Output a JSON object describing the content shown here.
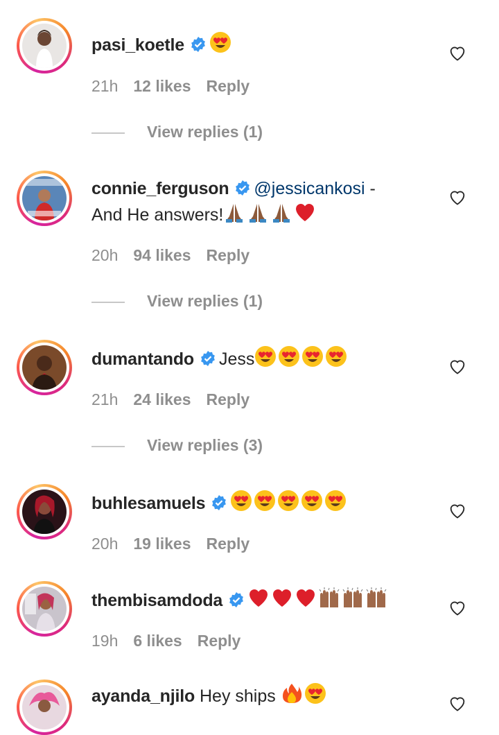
{
  "comments": [
    {
      "username": "pasi_koetle",
      "verified": true,
      "text": "",
      "emojis": [
        "heart-eyes"
      ],
      "time": "21h",
      "likes": "12 likes",
      "reply": "Reply",
      "view_replies": "View replies (1)"
    },
    {
      "username": "connie_ferguson",
      "verified": true,
      "mention": "@jessicankosi",
      "text_line1_suffix": " -",
      "text_line2": "And He answers!",
      "emojis": [
        "folded-hands",
        "folded-hands",
        "folded-hands",
        "red-heart"
      ],
      "time": "20h",
      "likes": "94 likes",
      "reply": "Reply",
      "view_replies": "View replies (1)"
    },
    {
      "username": "dumantando",
      "verified": true,
      "text": "Jess",
      "emojis": [
        "heart-eyes",
        "heart-eyes",
        "heart-eyes",
        "heart-eyes"
      ],
      "time": "21h",
      "likes": "24 likes",
      "reply": "Reply",
      "view_replies": "View replies (3)"
    },
    {
      "username": "buhlesamuels",
      "verified": true,
      "text": "",
      "emojis": [
        "heart-eyes",
        "heart-eyes",
        "heart-eyes",
        "heart-eyes",
        "heart-eyes"
      ],
      "time": "20h",
      "likes": "19 likes",
      "reply": "Reply"
    },
    {
      "username": "thembisamdoda",
      "verified": true,
      "text": "",
      "emojis": [
        "red-heart",
        "red-heart",
        "red-heart",
        "raising-hands",
        "raising-hands",
        "raising-hands"
      ],
      "time": "19h",
      "likes": "6 likes",
      "reply": "Reply"
    },
    {
      "username": "ayanda_njilo",
      "verified": false,
      "text": "Hey ships",
      "emojis": [
        "fire",
        "heart-eyes"
      ]
    }
  ],
  "colors": {
    "text": "#262626",
    "meta": "#8e8e8e",
    "mention": "#00376b",
    "verified": "#3897f0",
    "heart": "#ed4956"
  }
}
